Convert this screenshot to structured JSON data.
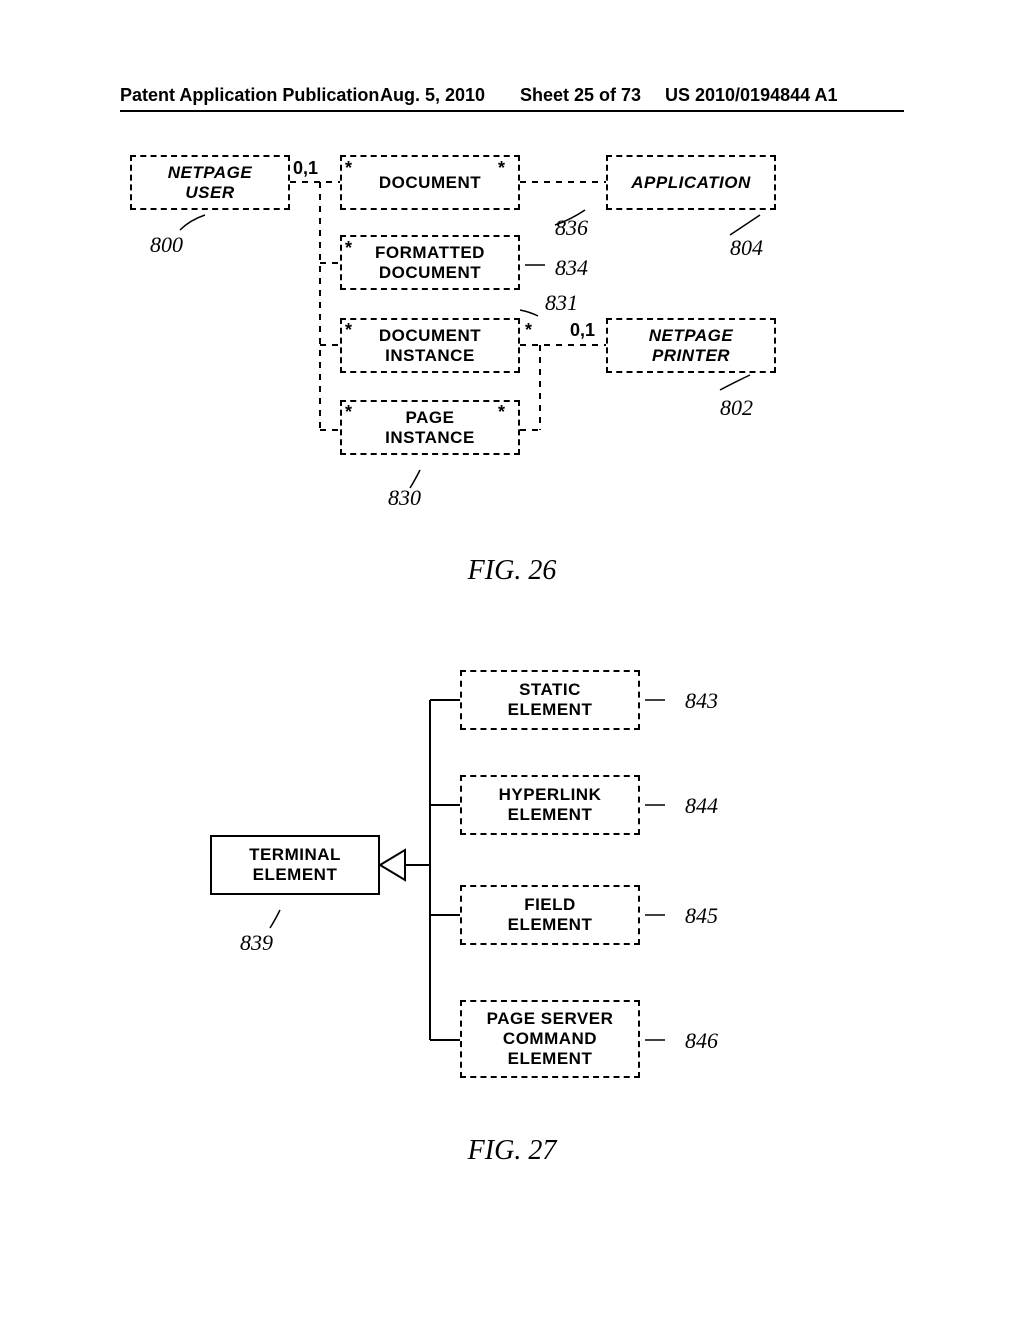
{
  "header": {
    "left": "Patent Application Publication",
    "date": "Aug. 5, 2010",
    "sheet": "Sheet 25 of 73",
    "pub": "US 2010/0194844 A1"
  },
  "fig26": {
    "caption": "FIG. 26",
    "boxes": {
      "netpage_user": {
        "l1": "NETPAGE",
        "l2": "USER"
      },
      "document": "DOCUMENT",
      "application": "APPLICATION",
      "formatted_document": {
        "l1": "FORMATTED",
        "l2": "DOCUMENT"
      },
      "document_instance": {
        "l1": "DOCUMENT",
        "l2": "INSTANCE"
      },
      "netpage_printer": {
        "l1": "NETPAGE",
        "l2": "PRINTER"
      },
      "page_instance": {
        "l1": "PAGE",
        "l2": "INSTANCE"
      }
    },
    "mult": {
      "user_r": "0,1",
      "doc_l": "*",
      "doc_r": "*",
      "fdoc_l": "*",
      "dinst_l": "*",
      "dinst_r": "*",
      "printer_l": "0,1",
      "pinst_l": "*",
      "pinst_r": "*"
    },
    "refs": {
      "r800": "800",
      "r836": "836",
      "r804": "804",
      "r834": "834",
      "r831": "831",
      "r802": "802",
      "r830": "830"
    }
  },
  "fig27": {
    "caption": "FIG. 27",
    "boxes": {
      "terminal_element": {
        "l1": "TERMINAL",
        "l2": "ELEMENT"
      },
      "static_element": {
        "l1": "STATIC",
        "l2": "ELEMENT"
      },
      "hyperlink_element": {
        "l1": "HYPERLINK",
        "l2": "ELEMENT"
      },
      "field_element": {
        "l1": "FIELD",
        "l2": "ELEMENT"
      },
      "page_server_command_element": {
        "l1": "PAGE SERVER",
        "l2": "COMMAND",
        "l3": "ELEMENT"
      }
    },
    "refs": {
      "r839": "839",
      "r843": "843",
      "r844": "844",
      "r845": "845",
      "r846": "846"
    }
  }
}
